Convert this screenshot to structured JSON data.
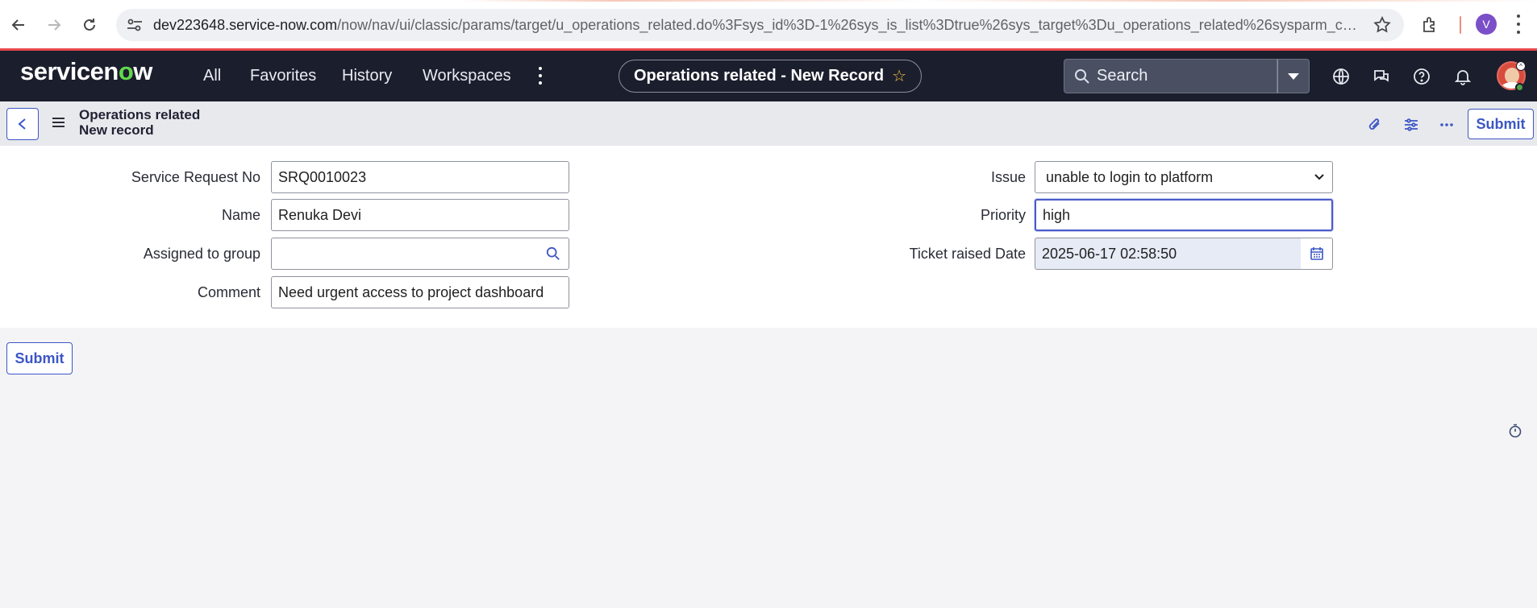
{
  "browser": {
    "url_host": "dev223648.service-now.com",
    "url_path": "/now/nav/ui/classic/params/target/u_operations_related.do%3Fsys_id%3D-1%26sys_is_list%3Dtrue%26sys_target%3Du_operations_related%26sysparm_checked_ite...",
    "profile_initial": "V"
  },
  "header": {
    "logo": {
      "part1": "servicen",
      "part2": "o",
      "part3": "w"
    },
    "nav": [
      "All",
      "Favorites",
      "History",
      "Workspaces"
    ],
    "record_title": "Operations related - New Record",
    "search_placeholder": "Search"
  },
  "form_header": {
    "title_line1": "Operations related",
    "title_line2": "New record",
    "submit_label": "Submit"
  },
  "form": {
    "left": [
      {
        "label": "Service Request No",
        "value": "SRQ0010023"
      },
      {
        "label": "Name",
        "value": "Renuka Devi"
      },
      {
        "label": "Assigned to group",
        "value": ""
      },
      {
        "label": "Comment",
        "value": "Need urgent access to project dashboard"
      }
    ],
    "right": [
      {
        "label": "Issue",
        "value": "unable to login to platform"
      },
      {
        "label": "Priority",
        "value": "high"
      },
      {
        "label": "Ticket raised Date",
        "value": "2025-06-17 02:58:50"
      }
    ]
  },
  "footer": {
    "submit_label": "Submit"
  },
  "colors": {
    "header_bg": "#1b1e2c",
    "accent": "#3c56c4",
    "logo_green": "#62d84e",
    "alert_red": "#e8474d"
  }
}
